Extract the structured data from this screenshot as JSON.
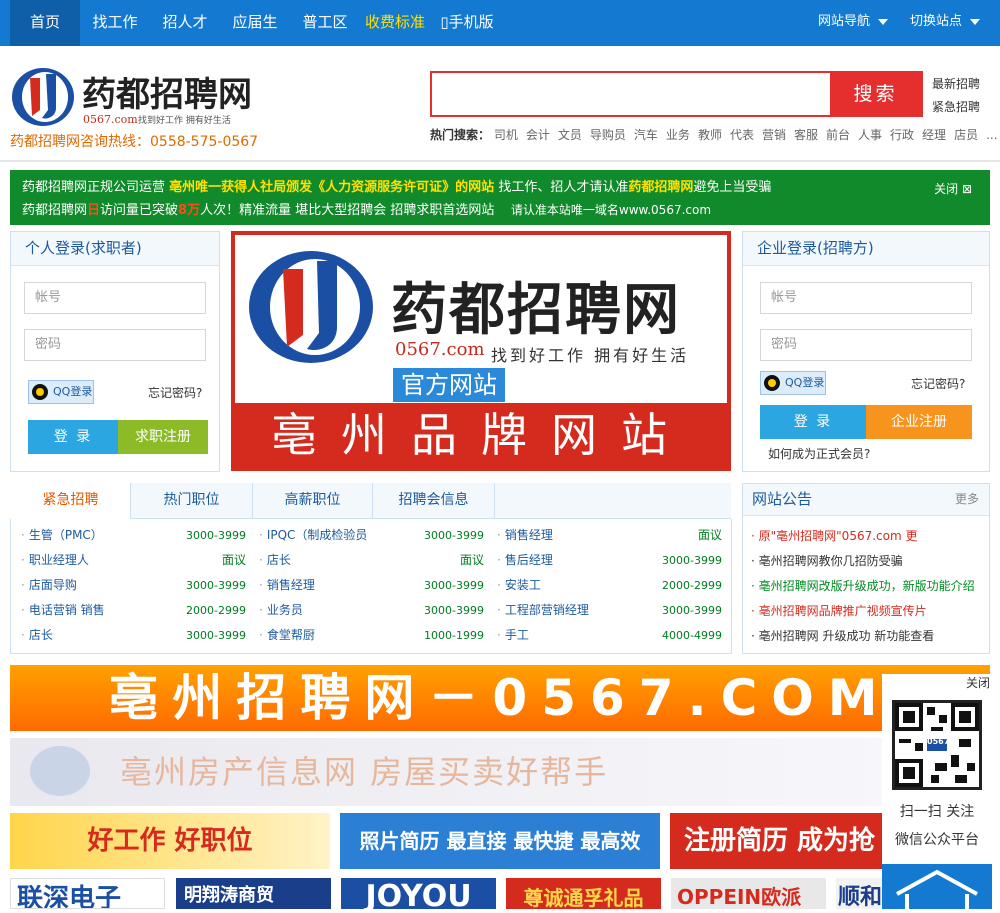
{
  "nav": {
    "items": [
      "首页",
      "找工作",
      "招人才",
      "应届生",
      "普工区",
      "收费标准",
      "手机版"
    ],
    "site_nav": "网站导航",
    "switch_site": "切换站点"
  },
  "header": {
    "logo_text": "药都招聘网",
    "logo_url": "0567.com",
    "logo_slogan": "找到好工作 拥有好生活",
    "hotline": "药都招聘网咨询热线：0558-575-0567",
    "search_button": "搜索",
    "quick_links": [
      "最新招聘",
      "紧急招聘"
    ],
    "hot_label": "热门搜索：",
    "hot_terms": [
      "司机",
      "会计",
      "文员",
      "导购员",
      "汽车",
      "业务",
      "教师",
      "代表",
      "营销",
      "客服",
      "前台",
      "人事",
      "行政",
      "经理",
      "店员",
      "..."
    ]
  },
  "notice": {
    "line1_a": "药都招聘网正规公司运营",
    "line1_b": "亳州唯一获得人社局颁发《人力资源服务许可证》的网站",
    "line1_c": "找工作、招人才请认准",
    "line1_d": "药都招聘网",
    "line1_e": "避免上当受骗",
    "line2_a": "药都招聘网",
    "line2_b": "日",
    "line2_c": "访问量已突破",
    "line2_d": "8万",
    "line2_e": "人次！精准流量 堪比大型招聘会 招聘求职首选网站",
    "line2_f": "请认准本站唯一域名www.0567.com",
    "close": "关闭"
  },
  "person_login": {
    "title": "个人登录(求职者)",
    "account_placeholder": "帐号",
    "password_placeholder": "密码",
    "qq": "QQ登录",
    "forgot": "忘记密码?",
    "login": "登 录",
    "register": "求职注册"
  },
  "company_login": {
    "title": "企业登录(招聘方)",
    "account_placeholder": "帐号",
    "password_placeholder": "密码",
    "qq": "QQ登录",
    "forgot": "忘记密码?",
    "login": "登 录",
    "register": "企业注册",
    "member": "如何成为正式会员?"
  },
  "banner": {
    "name": "药都招聘网",
    "url": "0567.com",
    "slogan": "找到好工作 拥有好生活",
    "official": "官方网站",
    "bottom": "亳州品牌网站"
  },
  "tabs": [
    "紧急招聘",
    "热门职位",
    "高薪职位",
    "招聘会信息"
  ],
  "jobs": [
    [
      {
        "name": "生管（PMC）",
        "salary": "3000-3999"
      },
      {
        "name": "职业经理人",
        "salary": "面议"
      },
      {
        "name": "店面导购",
        "salary": "3000-3999"
      },
      {
        "name": "电话营销 销售",
        "salary": "2000-2999"
      },
      {
        "name": "店长",
        "salary": "3000-3999"
      }
    ],
    [
      {
        "name": "IPQC（制成检验员",
        "salary": "3000-3999"
      },
      {
        "name": "店长",
        "salary": "面议"
      },
      {
        "name": "销售经理",
        "salary": "3000-3999"
      },
      {
        "name": "业务员",
        "salary": "3000-3999"
      },
      {
        "name": "食堂帮厨",
        "salary": "1000-1999"
      }
    ],
    [
      {
        "name": "销售经理",
        "salary": "面议"
      },
      {
        "name": "售后经理",
        "salary": "3000-3999"
      },
      {
        "name": "安装工",
        "salary": "2000-2999"
      },
      {
        "name": "工程部营销经理",
        "salary": "3000-3999"
      },
      {
        "name": "手工",
        "salary": "4000-4999"
      }
    ]
  ],
  "announcements": {
    "title": "网站公告",
    "more": "更多",
    "items": [
      {
        "text": "原\"亳州招聘网\"0567.com 更",
        "color": "#d52b1e"
      },
      {
        "text": "亳州招聘网教你几招防受骗",
        "color": "#333333"
      },
      {
        "text": "亳州招聘网改版升级成功，新版功能介绍",
        "color": "#008a22"
      },
      {
        "text": "亳州招聘网品牌推广视频宣传片",
        "color": "#d52b1e"
      },
      {
        "text": "亳州招聘网 升级成功 新功能查看",
        "color": "#333333"
      }
    ]
  },
  "ads": {
    "big": "亳州招聘网－0567.COM",
    "house": "亳州房产信息网 房屋买卖好帮手",
    "a1": "好工作 好职位",
    "a2": "照片简历 最直接 最快捷 最高效",
    "a3": "注册简历 成为抢",
    "b1": "联深电子",
    "b2": "明翔涛商贸",
    "b3": "JOYOU",
    "b4": "尊诚通孚礼品",
    "b5": "OPPEIN欧派",
    "b6": "顺和集团办厂"
  },
  "float": {
    "close": "关闭",
    "qr_label": "0567",
    "line1": "扫一扫 关注",
    "line2": "微信公众平台"
  }
}
